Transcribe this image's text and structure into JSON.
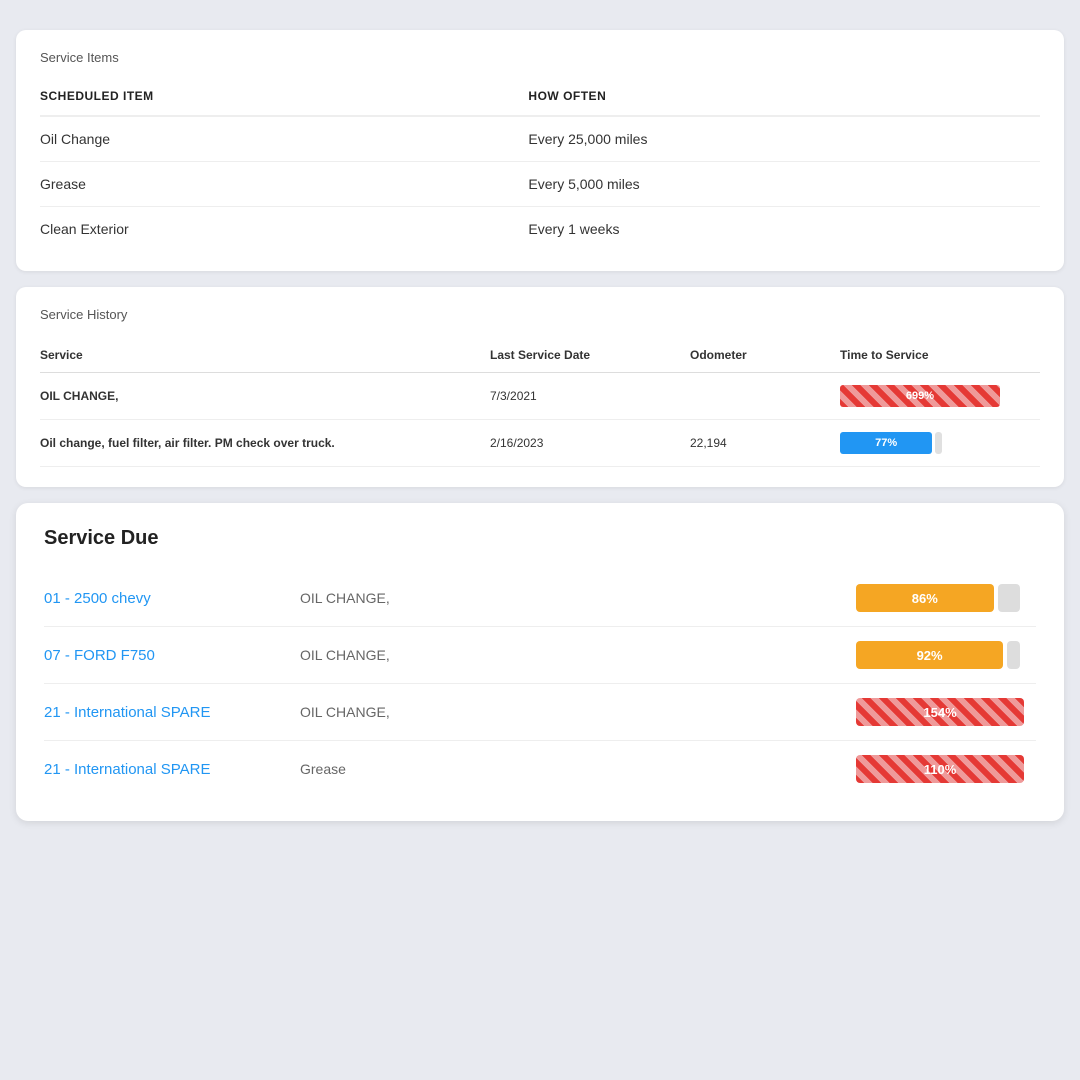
{
  "serviceItems": {
    "title": "Service Items",
    "columns": {
      "scheduledItem": "SCHEDULED ITEM",
      "howOften": "HOW OFTEN"
    },
    "rows": [
      {
        "item": "Oil Change",
        "frequency": "Every 25,000 miles"
      },
      {
        "item": "Grease",
        "frequency": "Every 5,000 miles"
      },
      {
        "item": "Clean Exterior",
        "frequency": "Every 1 weeks"
      }
    ]
  },
  "serviceHistory": {
    "title": "Service History",
    "columns": {
      "service": "Service",
      "lastServiceDate": "Last Service Date",
      "odometer": "Odometer",
      "timeToService": "Time to Service"
    },
    "rows": [
      {
        "service": "OIL CHANGE,",
        "bold": true,
        "lastServiceDate": "7/3/2021",
        "odometer": "",
        "timeToServicePct": 699,
        "barType": "striped-red",
        "barLabel": "699%"
      },
      {
        "service": "Oil change, fuel filter, air filter. PM check over truck.",
        "bold": true,
        "lastServiceDate": "2/16/2023",
        "odometer": "22,194",
        "timeToServicePct": 77,
        "barType": "solid-blue",
        "barLabel": "77%"
      }
    ]
  },
  "serviceDue": {
    "title": "Service Due",
    "rows": [
      {
        "vehicle": "01 - 2500 chevy",
        "service": "OIL CHANGE,",
        "pct": 86,
        "pctLabel": "86%",
        "barType": "yellow",
        "remainder": 14
      },
      {
        "vehicle": "07 - FORD F750",
        "service": "OIL CHANGE,",
        "pct": 92,
        "pctLabel": "92%",
        "barType": "yellow",
        "remainder": 8
      },
      {
        "vehicle": "21 - International SPARE",
        "service": "OIL CHANGE,",
        "pct": 154,
        "pctLabel": "154%",
        "barType": "striped-red",
        "remainder": 0
      },
      {
        "vehicle": "21 - International SPARE",
        "service": "Grease",
        "pct": 110,
        "pctLabel": "110%",
        "barType": "striped-red",
        "remainder": 0
      }
    ]
  }
}
